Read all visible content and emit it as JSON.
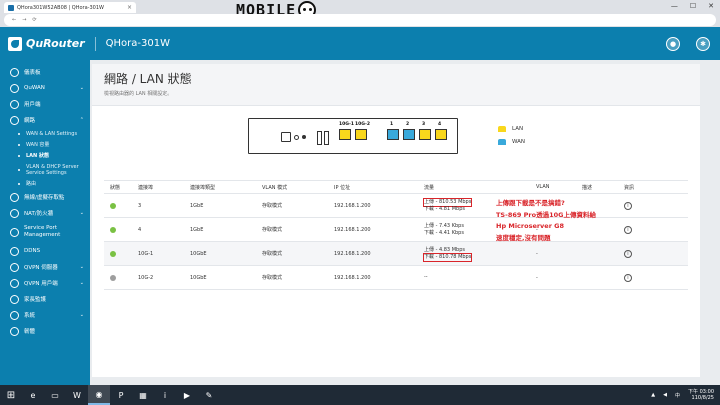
{
  "browser": {
    "tab_title": "QHora301W52AB08 | QHora-301W",
    "tab_close": "×",
    "window_buttons": [
      "—",
      "☐",
      "✕"
    ],
    "watermark_text": "MOBILE"
  },
  "header": {
    "brand": "QuRouter",
    "model": "QHora-301W",
    "user_icon": "user-icon",
    "settings_icon": "gear-icon"
  },
  "sidebar": {
    "items": [
      {
        "label": "儀表板",
        "icon": "dashboard-icon"
      },
      {
        "label": "QuWAN",
        "icon": "quwan-icon",
        "chevron": "⌄"
      },
      {
        "label": "用戶端",
        "icon": "clients-icon"
      },
      {
        "label": "網路",
        "icon": "globe-icon",
        "chevron": "⌃"
      }
    ],
    "network_sub": [
      {
        "label": "WAN & LAN Settings"
      },
      {
        "label": "WAN 容量"
      },
      {
        "label": "LAN 狀態",
        "active": true
      },
      {
        "label": "VLAN & DHCP Server Service Settings"
      },
      {
        "label": "路由"
      }
    ],
    "items_after": [
      {
        "label": "無線/虛擬存取點",
        "icon": "wifi-icon"
      },
      {
        "label": "NAT/防火牆",
        "icon": "firewall-icon",
        "chevron": "⌄"
      },
      {
        "label": "Service Port Management",
        "icon": "service-icon"
      },
      {
        "label": "DDNS",
        "icon": "ddns-icon"
      },
      {
        "label": "QVPN 伺服器",
        "icon": "vpn-server-icon",
        "chevron": "⌄"
      },
      {
        "label": "QVPN 用戶端",
        "icon": "vpn-client-icon",
        "chevron": "⌄"
      },
      {
        "label": "家長監護",
        "icon": "parental-icon"
      },
      {
        "label": "系統",
        "icon": "system-icon",
        "chevron": "⌄"
      },
      {
        "label": "韌體",
        "icon": "firmware-icon"
      }
    ]
  },
  "page": {
    "title": "網路 / LAN 狀態",
    "subtitle": "檢視路由器的 LAN 相關設定。"
  },
  "diagram": {
    "port_labels": [
      "10G-1",
      "10G-2",
      "1",
      "2",
      "3",
      "4"
    ],
    "legend": [
      {
        "label": "LAN",
        "color": "#f9d71c"
      },
      {
        "label": "WAN",
        "color": "#39a9db"
      }
    ]
  },
  "table": {
    "headers": [
      "狀態",
      "連接埠",
      "連接埠類型",
      "VLAN 模式",
      "IP 位址",
      "流量",
      "VLAN",
      "描述",
      "資訊"
    ],
    "rows": [
      {
        "status_color": "#7ac143",
        "port": "3",
        "type": "1GbE",
        "vlan_mode": "存取模式",
        "ip": "192.168.1.200",
        "up": "上傳 - 810.53 Mbps",
        "down": "下載 - 4.81 Mbps",
        "vlan": "",
        "desc": ""
      },
      {
        "status_color": "#7ac143",
        "port": "4",
        "type": "1GbE",
        "vlan_mode": "存取模式",
        "ip": "192.168.1.200",
        "up": "上傳 - 7.43 Kbps",
        "down": "下載 - 4.41 Kbps",
        "vlan": "-",
        "desc": ""
      },
      {
        "status_color": "#7ac143",
        "port": "10G-1",
        "type": "10GbE",
        "vlan_mode": "存取模式",
        "ip": "192.168.1.200",
        "up": "上傳 - 4.83 Mbps",
        "down": "下載 - 810.78 Mbps",
        "vlan": "-",
        "desc": ""
      },
      {
        "status_color": "#9e9e9e",
        "port": "10G-2",
        "type": "10GbE",
        "vlan_mode": "存取模式",
        "ip": "192.168.1.200",
        "up": "--",
        "down": "",
        "vlan": "-",
        "desc": ""
      }
    ]
  },
  "annotation": {
    "lines": [
      "上傳跟下載是不是搞錯?",
      "TS-869 Pro透過10G上傳資料給",
      "Hp Microserver G8",
      "速度穩定,沒有問題"
    ]
  },
  "taskbar": {
    "time": "下午 03:00",
    "date": "110/8/25",
    "language": "中"
  }
}
